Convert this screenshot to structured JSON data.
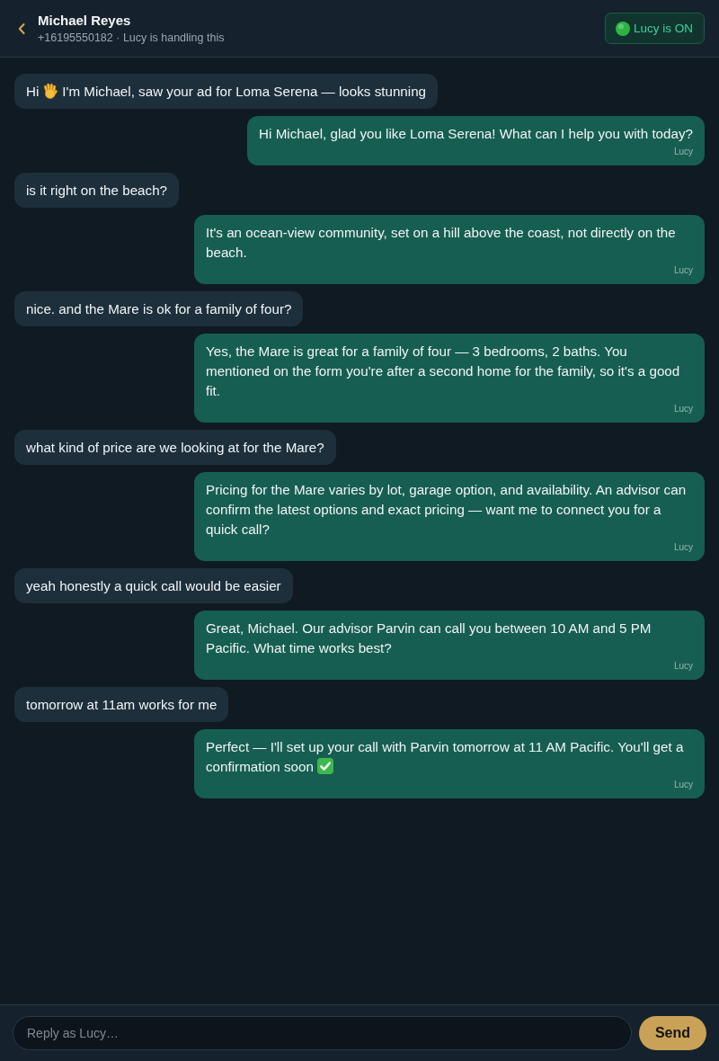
{
  "header": {
    "title": "Michael Reyes",
    "subtitle": "+16195550182 · Lucy is handling this",
    "toggle": {
      "label": "Lucy is ON",
      "on": true
    }
  },
  "messages": [
    {
      "kind": "lead",
      "parts": [
        {
          "kind": "text",
          "text": "Hi"
        },
        {
          "kind": "wave"
        },
        {
          "kind": "text",
          "text": "I'm Michael, saw your ad for Loma Serena — looks stunning"
        }
      ]
    },
    {
      "kind": "agent",
      "parts": [
        {
          "kind": "text",
          "text": "Hi Michael, glad you like Loma Serena! What can I help you with today?"
        }
      ],
      "sender": "Lucy"
    },
    {
      "kind": "lead",
      "parts": [
        {
          "kind": "text",
          "text": "is it right on the beach?"
        }
      ]
    },
    {
      "kind": "agent",
      "parts": [
        {
          "kind": "text",
          "text": "It's an ocean-view community, set on a hill above the coast, not directly on the beach."
        }
      ],
      "sender": "Lucy"
    },
    {
      "kind": "lead",
      "parts": [
        {
          "kind": "text",
          "text": "nice. and the Mare is ok for a family of four?"
        }
      ]
    },
    {
      "kind": "agent",
      "parts": [
        {
          "kind": "text",
          "text": "Yes, the Mare is great for a family of four — 3 bedrooms, 2 baths. You mentioned on the form you're after a second home for the family, so it's a good fit."
        }
      ],
      "sender": "Lucy"
    },
    {
      "kind": "lead",
      "parts": [
        {
          "kind": "text",
          "text": "what kind of price are we looking at for the Mare?"
        }
      ]
    },
    {
      "kind": "agent",
      "parts": [
        {
          "kind": "text",
          "text": "Pricing for the Mare varies by lot, garage option, and availability. An advisor can confirm the latest options and exact pricing — want me to connect you for a quick call?"
        }
      ],
      "sender": "Lucy"
    },
    {
      "kind": "lead",
      "parts": [
        {
          "kind": "text",
          "text": "yeah honestly a quick call would be easier"
        }
      ]
    },
    {
      "kind": "agent",
      "parts": [
        {
          "kind": "text",
          "text": "Great, Michael. Our advisor Parvin can call you between 10 AM and 5 PM Pacific. What time works best?"
        }
      ],
      "sender": "Lucy"
    },
    {
      "kind": "lead",
      "parts": [
        {
          "kind": "text",
          "text": "tomorrow at 11am works for me"
        }
      ]
    },
    {
      "kind": "agent",
      "parts": [
        {
          "kind": "text",
          "text": "Perfect — I'll set up your call with Parvin tomorrow at 11 AM Pacific. You'll get a"
        },
        {
          "kind": "text",
          "text": "confirmation soon"
        },
        {
          "kind": "check"
        }
      ],
      "sender": "Lucy"
    }
  ],
  "composer": {
    "placeholder": "Reply as Lucy…",
    "send_label": "Send"
  }
}
